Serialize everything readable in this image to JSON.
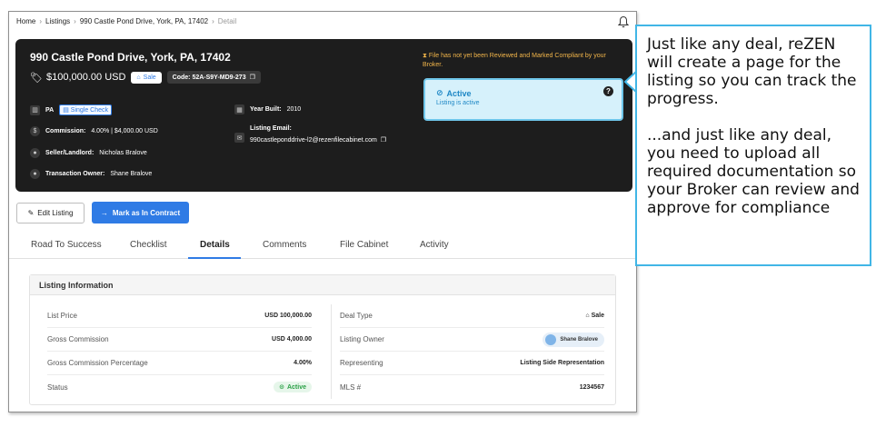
{
  "breadcrumb": {
    "home": "Home",
    "listings": "Listings",
    "address": "990 Castle Pond Drive, York, PA, 17402",
    "current": "Detail"
  },
  "hero": {
    "address": "990 Castle Pond Drive, York, PA, 17402",
    "price": "$100,000.00 USD",
    "sale_pill": "Sale",
    "code": "Code: 52A-S9Y-MD9-273",
    "state": "PA",
    "single_check": "Single Check",
    "commission_label": "Commission:",
    "commission_value": "4.00% | $4,000.00 USD",
    "seller_label": "Seller/Landlord:",
    "seller_value": "Nicholas Bralove",
    "owner_label": "Transaction Owner:",
    "owner_value": "Shane Bralove",
    "year_label": "Year Built:",
    "year_value": "2010",
    "email_label": "Listing Email:",
    "email_value": "990castleponddrive-l2@rezenfilecabinet.com",
    "warning": "File has not yet been Reviewed and Marked Compliant by your Broker.",
    "status_title": "Active",
    "status_sub": "Listing is active"
  },
  "actions": {
    "edit": "Edit Listing",
    "mark": "Mark as In Contract"
  },
  "tabs": [
    {
      "label": "Road To Success"
    },
    {
      "label": "Checklist"
    },
    {
      "label": "Details"
    },
    {
      "label": "Comments"
    },
    {
      "label": "File Cabinet"
    },
    {
      "label": "Activity"
    }
  ],
  "selected_tab": "Details",
  "panel": {
    "title": "Listing Information",
    "left": [
      {
        "k": "List Price",
        "v": "USD 100,000.00"
      },
      {
        "k": "Gross Commission",
        "v": "USD 4,000.00"
      },
      {
        "k": "Gross Commission Percentage",
        "v": "4.00%"
      },
      {
        "k": "Status",
        "v": "Active"
      }
    ],
    "right": [
      {
        "k": "Deal Type",
        "v": "Sale"
      },
      {
        "k": "Listing Owner",
        "v": "Shane Bralove"
      },
      {
        "k": "Representing",
        "v": "Listing Side Representation"
      },
      {
        "k": "MLS #",
        "v": "1234567"
      }
    ]
  },
  "callout": {
    "p1": "Just like any deal, reZEN will create a page for the listing so you can track the progress.",
    "p2": "...and just like any deal, you need to upload all required documentation so your Broker can review and approve for compliance"
  },
  "colors": {
    "accent": "#2f7be5",
    "hero_bg": "#1d1d1d",
    "warning": "#f2b54a",
    "active_card": "#d6f1fb",
    "callout_border": "#41b6e6",
    "status_green": "#2aa046"
  }
}
